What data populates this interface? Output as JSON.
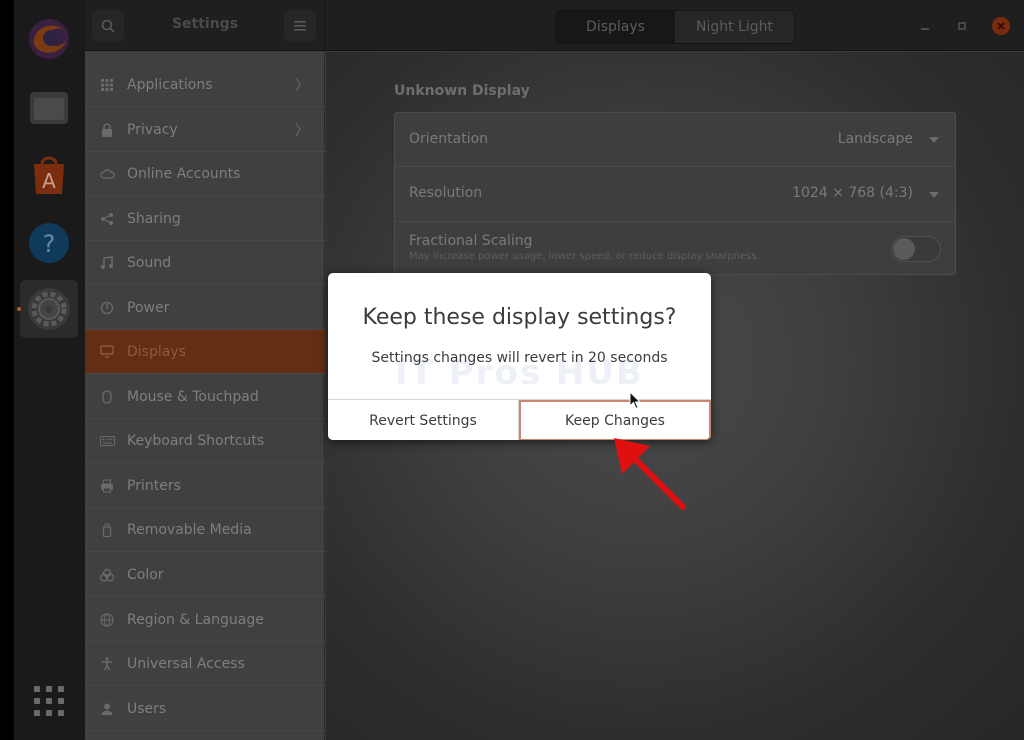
{
  "dock": {
    "apps": [
      {
        "name": "firefox-icon"
      },
      {
        "name": "files-icon"
      },
      {
        "name": "software-icon"
      },
      {
        "name": "help-icon"
      },
      {
        "name": "settings-icon"
      }
    ]
  },
  "header": {
    "title": "Settings",
    "tabs": [
      "Displays",
      "Night Light"
    ]
  },
  "sidebar": {
    "items": [
      {
        "label": "Applications",
        "icon": "apps-grid-icon",
        "chevron": "〉"
      },
      {
        "label": "Privacy",
        "icon": "lock-icon",
        "chevron": "〉"
      },
      {
        "label": "Online Accounts",
        "icon": "cloud-icon"
      },
      {
        "label": "Sharing",
        "icon": "share-icon"
      },
      {
        "label": "Sound",
        "icon": "music-note-icon"
      },
      {
        "label": "Power",
        "icon": "power-icon"
      },
      {
        "label": "Displays",
        "icon": "display-icon"
      },
      {
        "label": "Mouse & Touchpad",
        "icon": "mouse-icon"
      },
      {
        "label": "Keyboard Shortcuts",
        "icon": "keyboard-icon"
      },
      {
        "label": "Printers",
        "icon": "printer-icon"
      },
      {
        "label": "Removable Media",
        "icon": "usb-icon"
      },
      {
        "label": "Color",
        "icon": "color-icon"
      },
      {
        "label": "Region & Language",
        "icon": "globe-icon"
      },
      {
        "label": "Universal Access",
        "icon": "accessibility-icon"
      },
      {
        "label": "Users",
        "icon": "users-icon"
      }
    ],
    "selected": "Displays"
  },
  "main": {
    "section_title": "Unknown Display",
    "orientation": {
      "label": "Orientation",
      "value": "Landscape"
    },
    "resolution": {
      "label": "Resolution",
      "value": "1024 × 768 (4:3)"
    },
    "scaling": {
      "label": "Fractional Scaling",
      "subtitle": "May increase power usage, lower speed, or reduce display sharpness.",
      "enabled": false
    }
  },
  "dialog": {
    "title": "Keep these display settings?",
    "message": "Settings changes will revert in 20 seconds",
    "watermark": "IT Pros HUB",
    "revert_label": "Revert Settings",
    "keep_label": "Keep Changes"
  },
  "colors": {
    "accent": "#E95420",
    "highlight_arrow": "#E01010"
  }
}
